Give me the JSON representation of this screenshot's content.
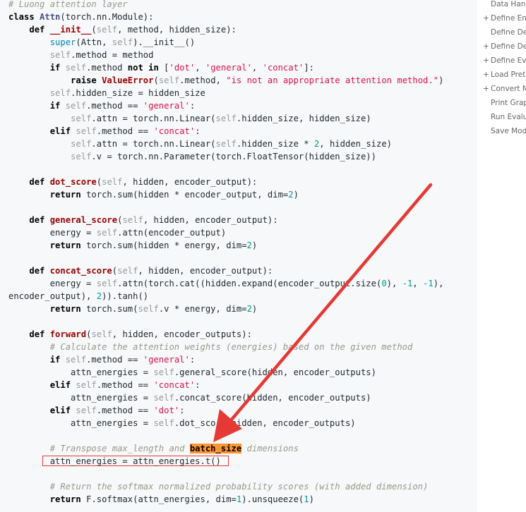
{
  "code": {
    "lines": [
      [
        [
          "cm",
          "# Luong attention layer"
        ]
      ],
      [
        [
          "kw",
          "class "
        ],
        [
          "cls",
          "Attn"
        ],
        [
          "p",
          "(torch.nn.Module):"
        ]
      ],
      [
        [
          "p",
          "    "
        ],
        [
          "kw",
          "def "
        ],
        [
          "fn",
          "__init__"
        ],
        [
          "p",
          "("
        ],
        [
          "self",
          "self"
        ],
        [
          "p",
          ", method, hidden_size):"
        ]
      ],
      [
        [
          "p",
          "        "
        ],
        [
          "bi",
          "super"
        ],
        [
          "p",
          "(Attn, "
        ],
        [
          "self",
          "self"
        ],
        [
          "p",
          ").__init__()"
        ]
      ],
      [
        [
          "p",
          "        "
        ],
        [
          "self",
          "self"
        ],
        [
          "p",
          ".method = method"
        ]
      ],
      [
        [
          "p",
          "        "
        ],
        [
          "kw",
          "if "
        ],
        [
          "self",
          "self"
        ],
        [
          "p",
          ".method "
        ],
        [
          "kw",
          "not in"
        ],
        [
          "p",
          " ["
        ],
        [
          "str",
          "'dot'"
        ],
        [
          "p",
          ", "
        ],
        [
          "str",
          "'general'"
        ],
        [
          "p",
          ", "
        ],
        [
          "str",
          "'concat'"
        ],
        [
          "p",
          "]:"
        ]
      ],
      [
        [
          "p",
          "            "
        ],
        [
          "kw",
          "raise "
        ],
        [
          "fn",
          "ValueError"
        ],
        [
          "p",
          "("
        ],
        [
          "self",
          "self"
        ],
        [
          "p",
          ".method, "
        ],
        [
          "str",
          "\"is not an appropriate attention method.\""
        ],
        [
          "p",
          ")"
        ]
      ],
      [
        [
          "p",
          "        "
        ],
        [
          "self",
          "self"
        ],
        [
          "p",
          ".hidden_size = hidden_size"
        ]
      ],
      [
        [
          "p",
          "        "
        ],
        [
          "kw",
          "if "
        ],
        [
          "self",
          "self"
        ],
        [
          "p",
          ".method == "
        ],
        [
          "str",
          "'general'"
        ],
        [
          "p",
          ":"
        ]
      ],
      [
        [
          "p",
          "            "
        ],
        [
          "self",
          "self"
        ],
        [
          "p",
          ".attn = torch.nn.Linear("
        ],
        [
          "self",
          "self"
        ],
        [
          "p",
          ".hidden_size, hidden_size)"
        ]
      ],
      [
        [
          "p",
          "        "
        ],
        [
          "kw",
          "elif "
        ],
        [
          "self",
          "self"
        ],
        [
          "p",
          ".method == "
        ],
        [
          "str",
          "'concat'"
        ],
        [
          "p",
          ":"
        ]
      ],
      [
        [
          "p",
          "            "
        ],
        [
          "self",
          "self"
        ],
        [
          "p",
          ".attn = torch.nn.Linear("
        ],
        [
          "self",
          "self"
        ],
        [
          "p",
          ".hidden_size * "
        ],
        [
          "num",
          "2"
        ],
        [
          "p",
          ", hidden_size)"
        ]
      ],
      [
        [
          "p",
          "            "
        ],
        [
          "self",
          "self"
        ],
        [
          "p",
          ".v = torch.nn.Parameter(torch.FloatTensor(hidden_size))"
        ]
      ],
      [],
      [
        [
          "p",
          "    "
        ],
        [
          "kw",
          "def "
        ],
        [
          "fn",
          "dot_score"
        ],
        [
          "p",
          "("
        ],
        [
          "self",
          "self"
        ],
        [
          "p",
          ", hidden, encoder_output):"
        ]
      ],
      [
        [
          "p",
          "        "
        ],
        [
          "kw",
          "return "
        ],
        [
          "p",
          "torch.sum(hidden * encoder_output, dim="
        ],
        [
          "num",
          "2"
        ],
        [
          "p",
          ")"
        ]
      ],
      [],
      [
        [
          "p",
          "    "
        ],
        [
          "kw",
          "def "
        ],
        [
          "fn",
          "general_score"
        ],
        [
          "p",
          "("
        ],
        [
          "self",
          "self"
        ],
        [
          "p",
          ", hidden, encoder_output):"
        ]
      ],
      [
        [
          "p",
          "        energy = "
        ],
        [
          "self",
          "self"
        ],
        [
          "p",
          ".attn(encoder_output)"
        ]
      ],
      [
        [
          "p",
          "        "
        ],
        [
          "kw",
          "return "
        ],
        [
          "p",
          "torch.sum(hidden * energy, dim="
        ],
        [
          "num",
          "2"
        ],
        [
          "p",
          ")"
        ]
      ],
      [],
      [
        [
          "p",
          "    "
        ],
        [
          "kw",
          "def "
        ],
        [
          "fn",
          "concat_score"
        ],
        [
          "p",
          "("
        ],
        [
          "self",
          "self"
        ],
        [
          "p",
          ", hidden, encoder_output):"
        ]
      ],
      [
        [
          "p",
          "        energy = "
        ],
        [
          "self",
          "self"
        ],
        [
          "p",
          ".attn(torch.cat((hidden.expand(encoder_output.size("
        ],
        [
          "num",
          "0"
        ],
        [
          "p",
          "), "
        ],
        [
          "num",
          "-1"
        ],
        [
          "p",
          ", "
        ],
        [
          "num",
          "-1"
        ],
        [
          "p",
          "),"
        ]
      ],
      [
        [
          "p",
          "encoder_output), "
        ],
        [
          "num",
          "2"
        ],
        [
          "p",
          ")).tanh()"
        ]
      ],
      [
        [
          "p",
          "        "
        ],
        [
          "kw",
          "return "
        ],
        [
          "p",
          "torch.sum("
        ],
        [
          "self",
          "self"
        ],
        [
          "p",
          ".v * energy, dim="
        ],
        [
          "num",
          "2"
        ],
        [
          "p",
          ")"
        ]
      ],
      [],
      [
        [
          "p",
          "    "
        ],
        [
          "kw",
          "def "
        ],
        [
          "fn",
          "forward"
        ],
        [
          "p",
          "("
        ],
        [
          "self",
          "self"
        ],
        [
          "p",
          ", hidden, encoder_outputs):"
        ]
      ],
      [
        [
          "p",
          "        "
        ],
        [
          "cm",
          "# Calculate the attention weights (energies) based on the given method"
        ]
      ],
      [
        [
          "p",
          "        "
        ],
        [
          "kw",
          "if "
        ],
        [
          "self",
          "self"
        ],
        [
          "p",
          ".method == "
        ],
        [
          "str",
          "'general'"
        ],
        [
          "p",
          ":"
        ]
      ],
      [
        [
          "p",
          "            attn_energies = "
        ],
        [
          "self",
          "self"
        ],
        [
          "p",
          ".general_score(hidden, encoder_outputs)"
        ]
      ],
      [
        [
          "p",
          "        "
        ],
        [
          "kw",
          "elif "
        ],
        [
          "self",
          "self"
        ],
        [
          "p",
          ".method == "
        ],
        [
          "str",
          "'concat'"
        ],
        [
          "p",
          ":"
        ]
      ],
      [
        [
          "p",
          "            attn_energies = "
        ],
        [
          "self",
          "self"
        ],
        [
          "p",
          ".concat_score(hidden, encoder_outputs)"
        ]
      ],
      [
        [
          "p",
          "        "
        ],
        [
          "kw",
          "elif "
        ],
        [
          "self",
          "self"
        ],
        [
          "p",
          ".method == "
        ],
        [
          "str",
          "'dot'"
        ],
        [
          "p",
          ":"
        ]
      ],
      [
        [
          "p",
          "            attn_energies = "
        ],
        [
          "self",
          "self"
        ],
        [
          "p",
          ".dot_score(hidden, encoder_outputs)"
        ]
      ],
      [],
      [
        [
          "p",
          "        "
        ],
        [
          "cm",
          "# Transpose max_length and "
        ],
        [
          "hl",
          "batch_size"
        ],
        [
          "cm",
          " dimensions"
        ]
      ],
      [
        [
          "p",
          "        attn_energies = attn_energies.t()"
        ]
      ],
      [],
      [
        [
          "p",
          "        "
        ],
        [
          "cm",
          "# Return the softmax normalized probability scores (with added dimension)"
        ]
      ],
      [
        [
          "p",
          "        "
        ],
        [
          "kw",
          "return "
        ],
        [
          "p",
          "F.softmax(attn_energies, dim="
        ],
        [
          "num",
          "1"
        ],
        [
          "p",
          ").unsqueeze("
        ],
        [
          "num",
          "1"
        ],
        [
          "p",
          ")"
        ]
      ]
    ]
  },
  "toc": {
    "items": [
      {
        "prefix": "",
        "label": "Data Handling"
      },
      {
        "prefix": "+",
        "label": "Define Encoder"
      },
      {
        "prefix": "",
        "label": "Define Decoder"
      },
      {
        "prefix": "+",
        "label": "Define Decoder"
      },
      {
        "prefix": "+",
        "label": "Define Evaluation"
      },
      {
        "prefix": "+",
        "label": "Load Pretrained"
      },
      {
        "prefix": "+",
        "label": "Convert Model"
      },
      {
        "prefix": "",
        "label": "Print Graph"
      },
      {
        "prefix": "",
        "label": "Run Evaluation"
      },
      {
        "prefix": "",
        "label": "Save Model"
      }
    ]
  },
  "colors": {
    "annotation": "#e53935",
    "highlight": "#ff9632"
  }
}
